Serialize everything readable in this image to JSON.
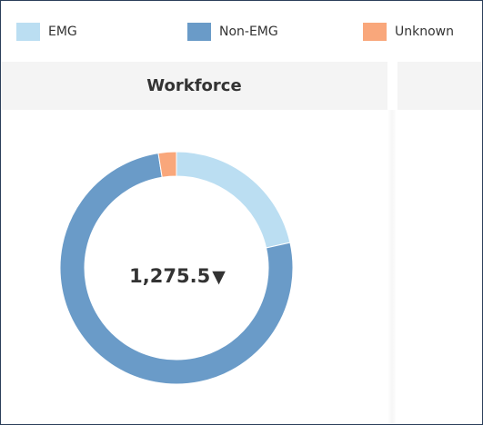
{
  "legend": {
    "items": [
      {
        "label": "EMG",
        "color": "#bbdef2"
      },
      {
        "label": "Non-EMG",
        "color": "#6a9bc8"
      },
      {
        "label": "Unknown",
        "color": "#f9a77b"
      }
    ]
  },
  "panel": {
    "title": "Workforce"
  },
  "chart_data": {
    "type": "pie",
    "title": "Workforce",
    "center_value": "1,275.5",
    "trend_icon": "down-triangle-icon",
    "legend_position": "top",
    "slices": [
      {
        "name": "EMG",
        "value": 21.5,
        "color": "#bbdef2"
      },
      {
        "name": "Non-EMG",
        "value": 76.0,
        "color": "#6a9bc8"
      },
      {
        "name": "Unknown",
        "value": 2.5,
        "color": "#f9a77b"
      }
    ]
  }
}
